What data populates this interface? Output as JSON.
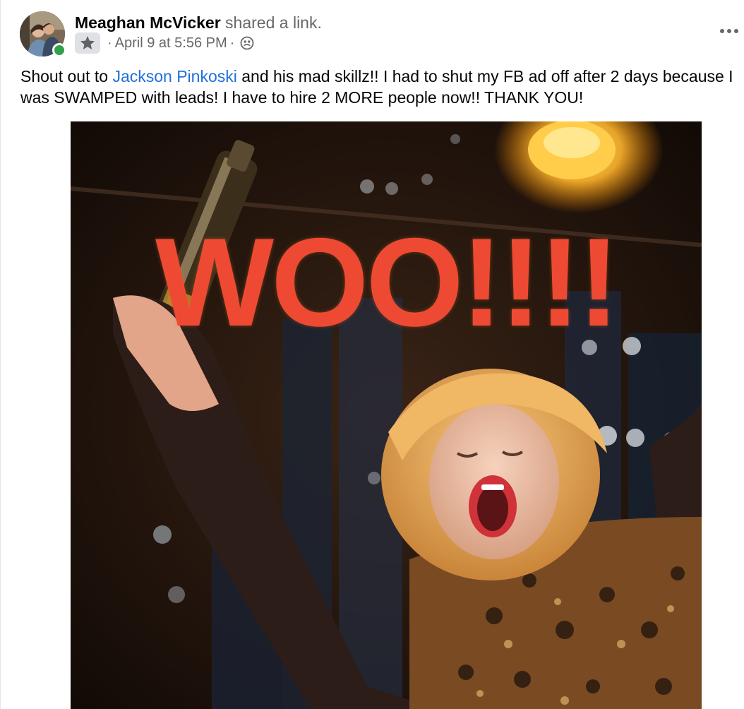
{
  "post": {
    "author": "Meaghan McVicker",
    "action": " shared a link.",
    "badge_icon": "star-badge-icon",
    "date_prefix": "·",
    "date": "April 9 at 5:56 PM",
    "date_suffix": "·",
    "audience_icon": "globe-icon",
    "more_icon": "more-options-icon",
    "text_before": "Shout out to ",
    "mention": "Jackson Pinkoski",
    "text_after": " and his mad skillz!! I had to shut my FB ad off after 2 days because I was SWAMPED with leads! I have to hire 2 MORE people now!! THANK YOU!",
    "media": {
      "caption": "WOO!!!!",
      "caption_color": "#ee4a33"
    }
  },
  "colors": {
    "name": "#050505",
    "secondary": "#65676b",
    "mention": "#216fdb",
    "online": "#31a24c",
    "badge_bg": "#dfe1e5"
  }
}
